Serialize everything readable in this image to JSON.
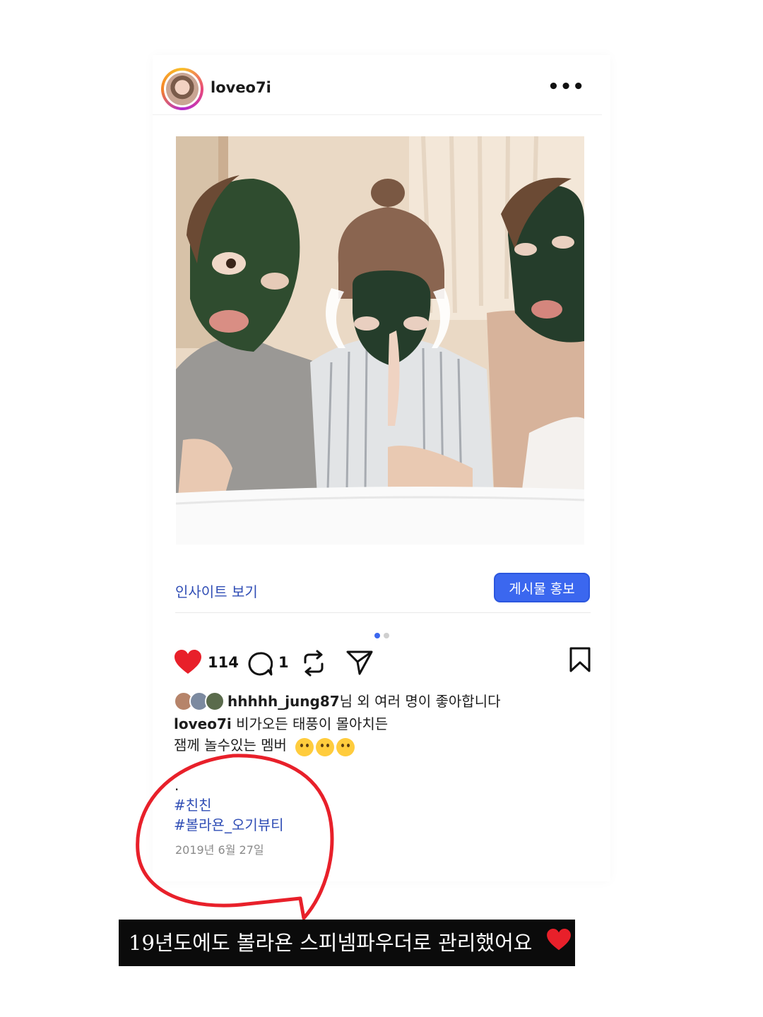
{
  "post": {
    "username": "loveo7i",
    "more_icon": "more-horizontal-icon",
    "photo_description": "three people wearing green face masks",
    "insights_label": "인사이트 보기",
    "promote_label": "게시물 홍보",
    "carousel": {
      "total": 2,
      "active": 1
    }
  },
  "actions": {
    "like_count": "114",
    "comment_count": "1",
    "icons": [
      "heart-icon",
      "comment-icon",
      "repost-icon",
      "share-icon",
      "bookmark-icon"
    ]
  },
  "likes": {
    "user": "hhhhh_jung87",
    "suffix": "님 외 여러 명이 좋아합니다"
  },
  "caption": {
    "author": "loveo7i",
    "line1": " 비가오든 태풍이 몰아치든",
    "line2": "잼께 놀수있는 멤버",
    "emojis": [
      "zany-face-emoji",
      "star-struck-emoji",
      "partying-face-emoji"
    ],
    "dot": ".",
    "hashtags": [
      "#친친",
      "#볼라욘_오기뷰티"
    ],
    "date": "2019년 6월 27일"
  },
  "banner": {
    "text": "19년도에도 볼라욘 스피넴파우더로 관리했어요",
    "emoji": "red-heart-emoji"
  },
  "colors": {
    "accent_blue": "#3b67ef",
    "link_blue": "#2f4db5",
    "like_red": "#e8202a",
    "annotation_red": "#e8202a"
  }
}
